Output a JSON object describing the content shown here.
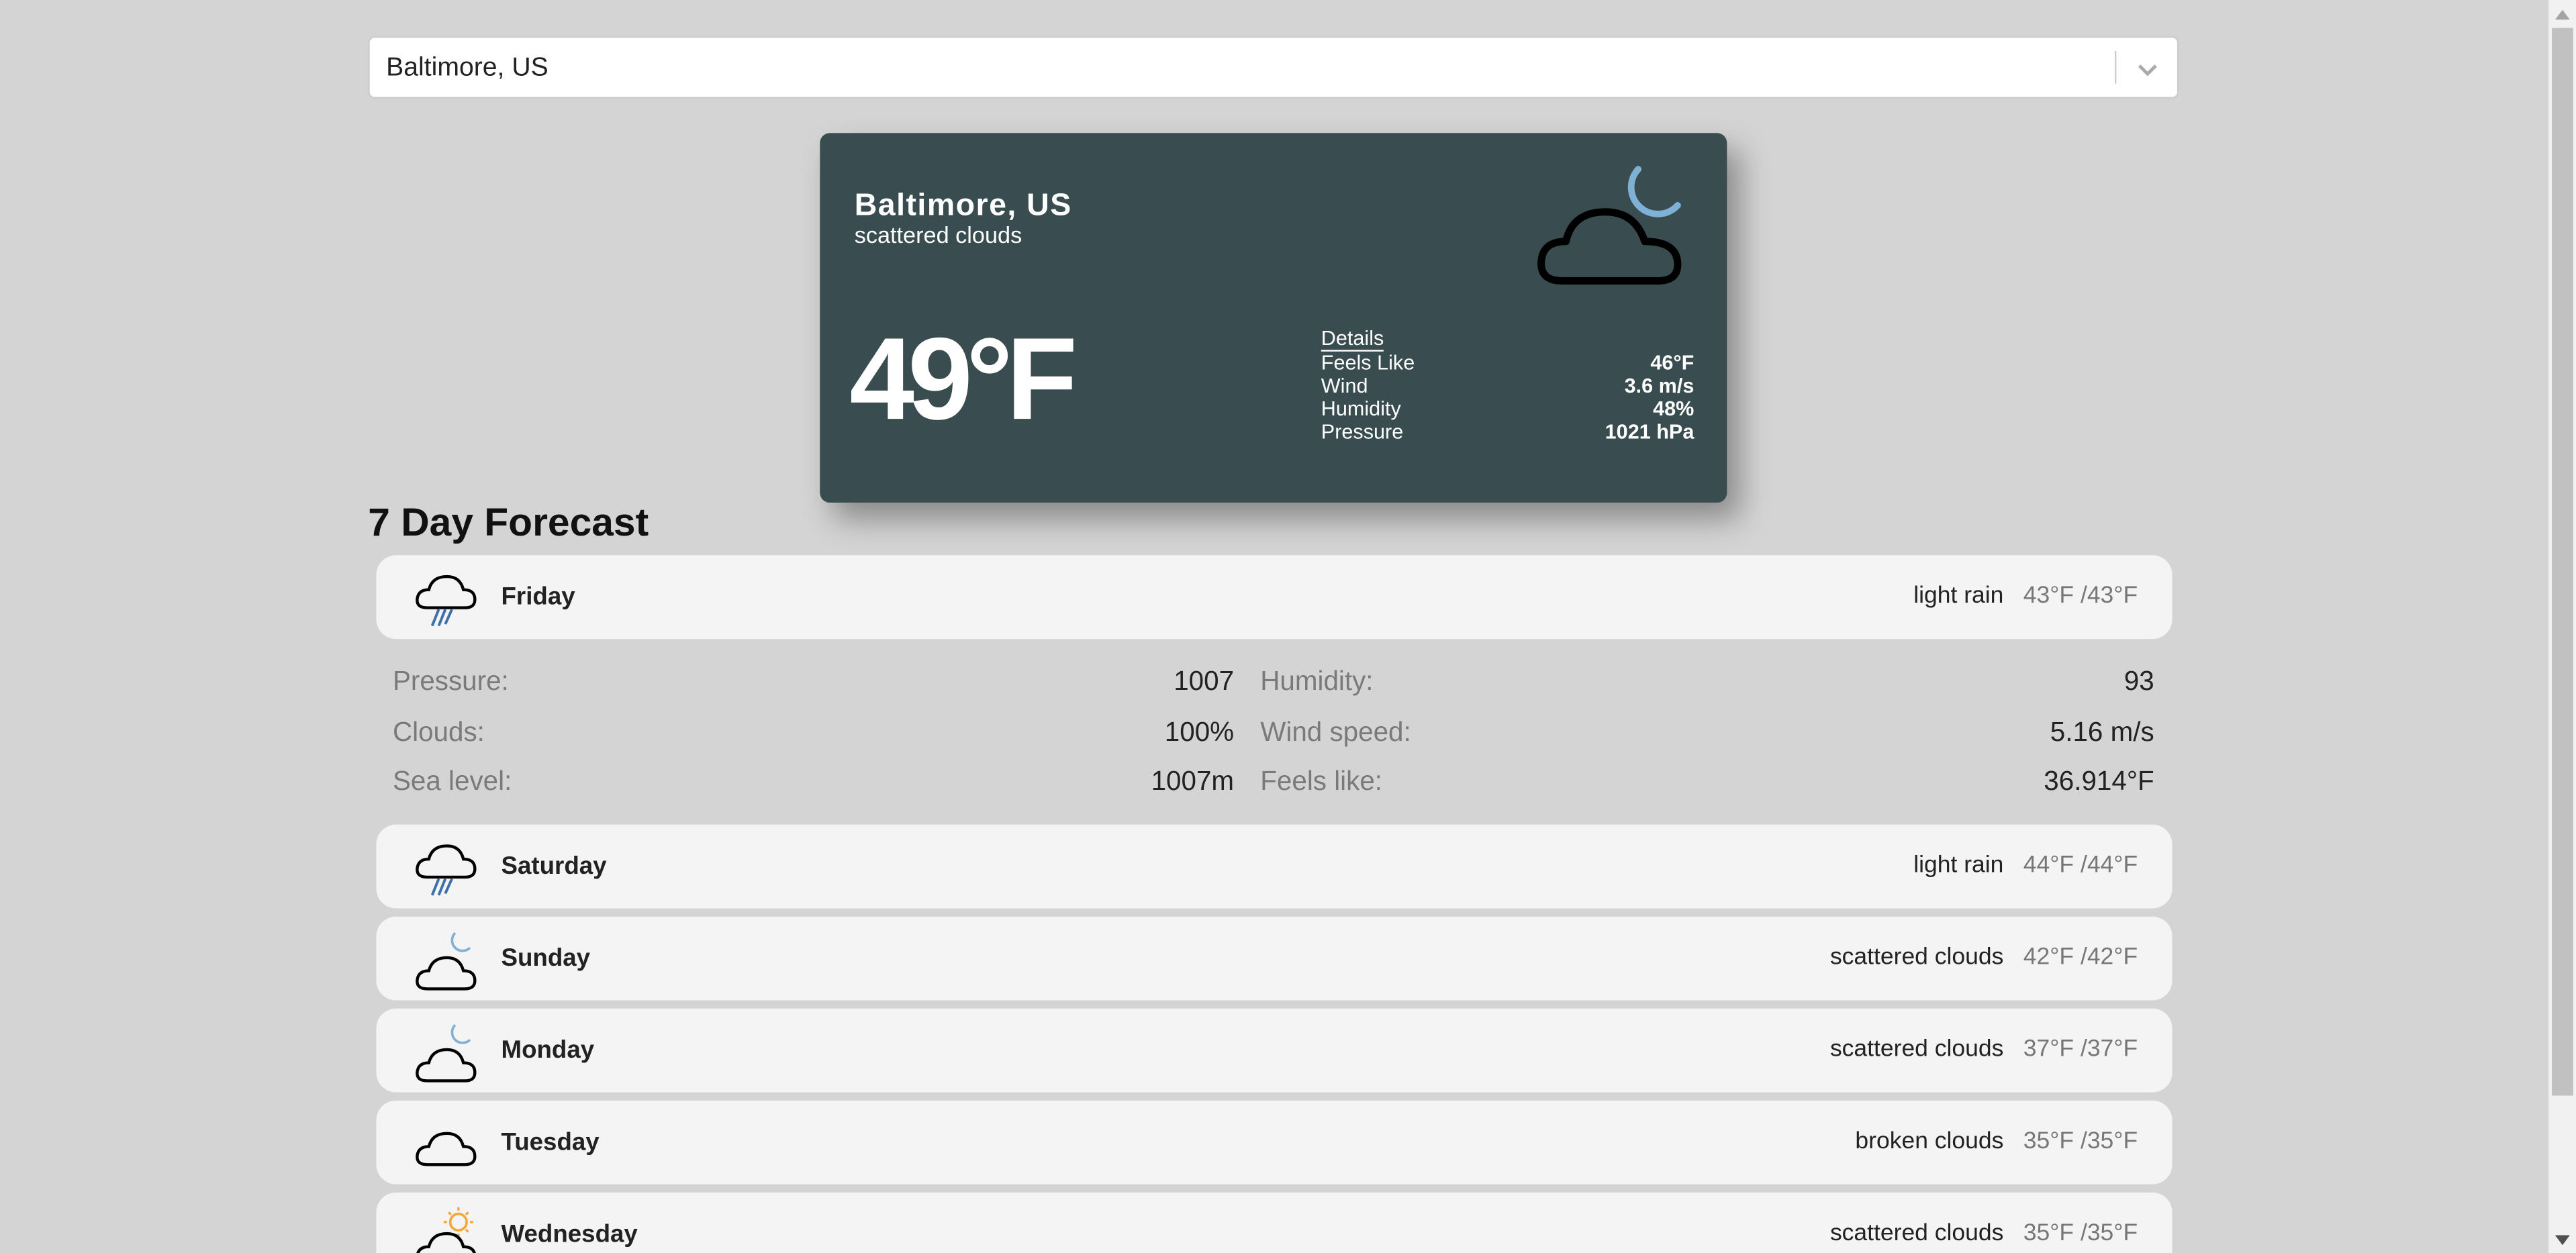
{
  "search": {
    "value": "Baltimore, US"
  },
  "current": {
    "city": "Baltimore, US",
    "description": "scattered clouds",
    "temperature": "49°F",
    "icon": "cloud-moon-icon",
    "details_title": "Details",
    "details": [
      {
        "label": "Feels Like",
        "value": "46°F"
      },
      {
        "label": "Wind",
        "value": "3.6 m/s"
      },
      {
        "label": "Humidity",
        "value": "48%"
      },
      {
        "label": "Pressure",
        "value": "1021 hPa"
      }
    ]
  },
  "forecast": {
    "title": "7 Day Forecast",
    "days": [
      {
        "name": "Friday",
        "description": "light rain",
        "temps": "43°F /43°F",
        "icon": "rain-cloud-icon",
        "expanded": true
      },
      {
        "name": "Saturday",
        "description": "light rain",
        "temps": "44°F /44°F",
        "icon": "rain-cloud-icon"
      },
      {
        "name": "Sunday",
        "description": "scattered clouds",
        "temps": "42°F /42°F",
        "icon": "cloud-moon-icon"
      },
      {
        "name": "Monday",
        "description": "scattered clouds",
        "temps": "37°F /37°F",
        "icon": "cloud-moon-icon"
      },
      {
        "name": "Tuesday",
        "description": "broken clouds",
        "temps": "35°F /35°F",
        "icon": "cloud-icon"
      },
      {
        "name": "Wednesday",
        "description": "scattered clouds",
        "temps": "35°F /35°F",
        "icon": "cloud-sun-icon"
      }
    ],
    "expanded_details": {
      "pressure_label": "Pressure:",
      "pressure": "1007",
      "humidity_label": "Humidity:",
      "humidity": "93",
      "clouds_label": "Clouds:",
      "clouds": "100%",
      "wind_label": "Wind speed:",
      "wind": "5.16 m/s",
      "sea_label": "Sea level:",
      "sea": "1007m",
      "feels_label": "Feels like:",
      "feels": "36.914°F"
    }
  },
  "colors": {
    "card_bg": "#394c4f",
    "page_bg": "#d4d4d4",
    "moon": "#7fb1d6",
    "sun": "#f2a93b",
    "rain": "#3d6fa8"
  }
}
